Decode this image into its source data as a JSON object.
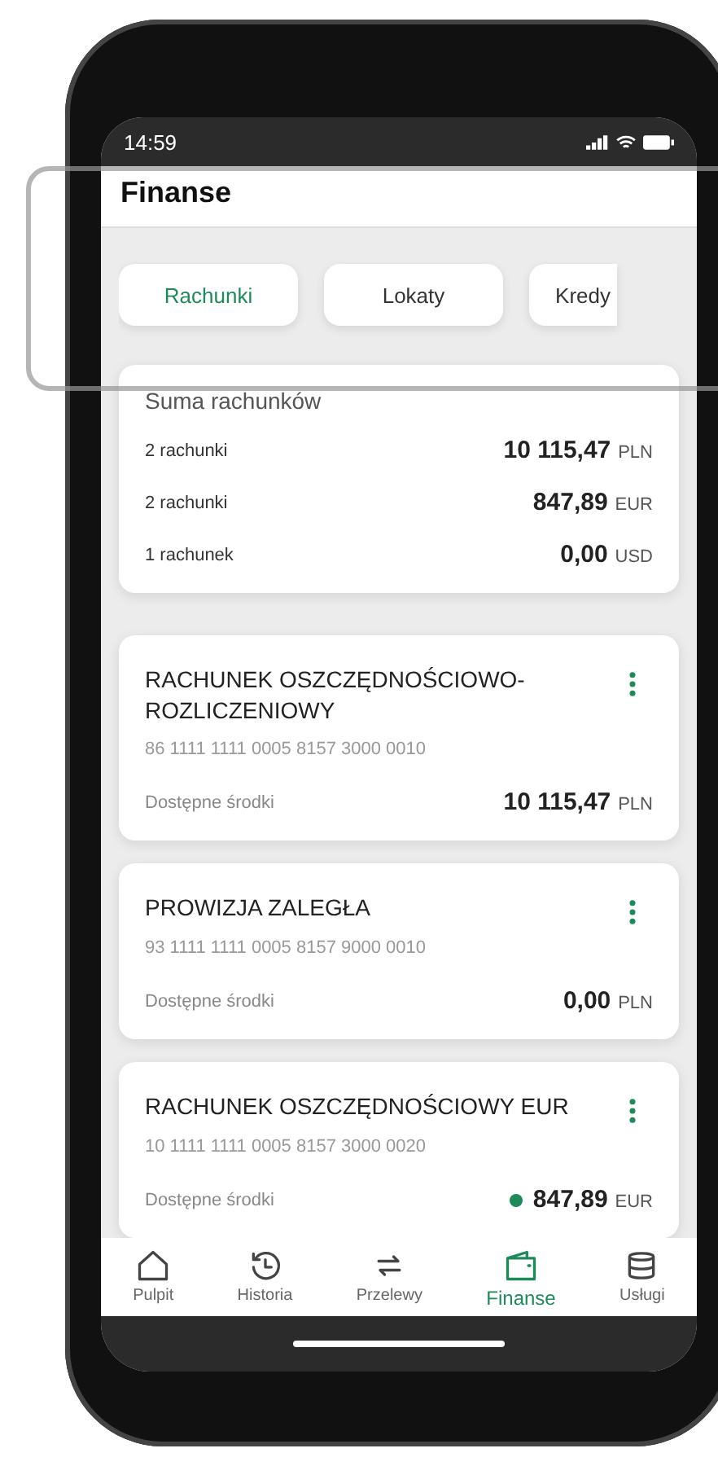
{
  "status_bar": {
    "time": "14:59"
  },
  "header": {
    "title": "Finanse"
  },
  "tabs": [
    {
      "label": "Rachunki",
      "selected": true
    },
    {
      "label": "Lokaty",
      "selected": false
    },
    {
      "label": "Kredy",
      "selected": false
    }
  ],
  "summary": {
    "title": "Suma rachunków",
    "rows": [
      {
        "label": "2 rachunki",
        "amount": "10 115,47",
        "currency": "PLN"
      },
      {
        "label": "2 rachunki",
        "amount": "847,89",
        "currency": "EUR"
      },
      {
        "label": "1 rachunek",
        "amount": "0,00",
        "currency": "USD"
      }
    ]
  },
  "accounts": [
    {
      "name": "RACHUNEK OSZCZĘDNOŚCIOWO-ROZLICZENIOWY",
      "number": "86 1111 1111 0005 8157 3000 0010",
      "balance_label": "Dostępne środki",
      "amount": "10 115,47",
      "currency": "PLN"
    },
    {
      "name": "PROWIZJA ZALEGŁA",
      "number": "93 1111 1111 0005 8157 9000 0010",
      "balance_label": "Dostępne środki",
      "amount": "0,00",
      "currency": "PLN"
    },
    {
      "name": "RACHUNEK OSZCZĘDNOŚCIOWY EUR",
      "number": "10 1111 1111 0005 8157 3000 0020",
      "balance_label": "Dostępne środki",
      "amount": "847,89",
      "currency": "EUR"
    }
  ],
  "nav": [
    {
      "label": "Pulpit",
      "selected": false
    },
    {
      "label": "Historia",
      "selected": false
    },
    {
      "label": "Przelewy",
      "selected": false
    },
    {
      "label": "Finanse",
      "selected": true
    },
    {
      "label": "Usługi",
      "selected": false
    }
  ]
}
